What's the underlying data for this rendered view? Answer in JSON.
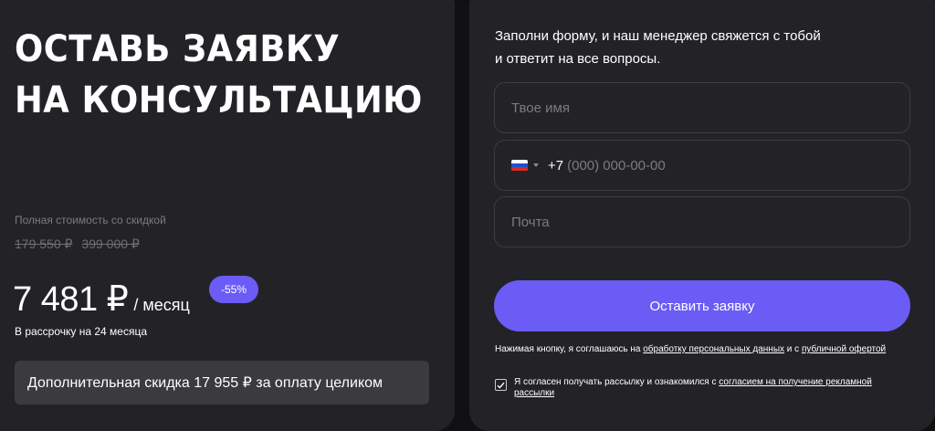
{
  "offer": {
    "title_line1": "Оставь заявку",
    "title_line2": "на консультацию",
    "price_caption": "Полная стоимость со скидкой",
    "old_price_discounted": "179 550 ₽",
    "old_price_full": "399 000 ₽",
    "monthly_price": "7 481 ₽",
    "monthly_unit": "/ месяц",
    "discount_badge": "-55%",
    "installment_text": "В рассрочку на 24 месяца",
    "extra_discount_text": "Дополнительная скидка 17 955 ₽ за оплату целиком"
  },
  "form": {
    "intro_line1": "Заполни форму, и наш менеджер свяжется с тобой",
    "intro_line2": "и ответит на все вопросы.",
    "name_placeholder": "Твое имя",
    "phone_code": "+7",
    "phone_placeholder": "(000) 000-00-00",
    "country_flag_icon": "russia-flag-icon",
    "email_placeholder": "Почта",
    "submit_label": "Оставить заявку",
    "legal_prefix": "Нажимая кнопку, я соглашаюсь на ",
    "legal_link1": "обработку персональных данных",
    "legal_middle": " и с ",
    "legal_link2": "публичной офертой",
    "consent_checked": true,
    "consent_prefix": "Я согласен получать рассылку и ознакомился с ",
    "consent_link": "согласием на получение рекламной рассылки"
  },
  "colors": {
    "background": "#111113",
    "card": "#232327",
    "accent": "#6b5cf6",
    "muted_text": "#7b7b80",
    "field_border": "#3c3c41"
  }
}
